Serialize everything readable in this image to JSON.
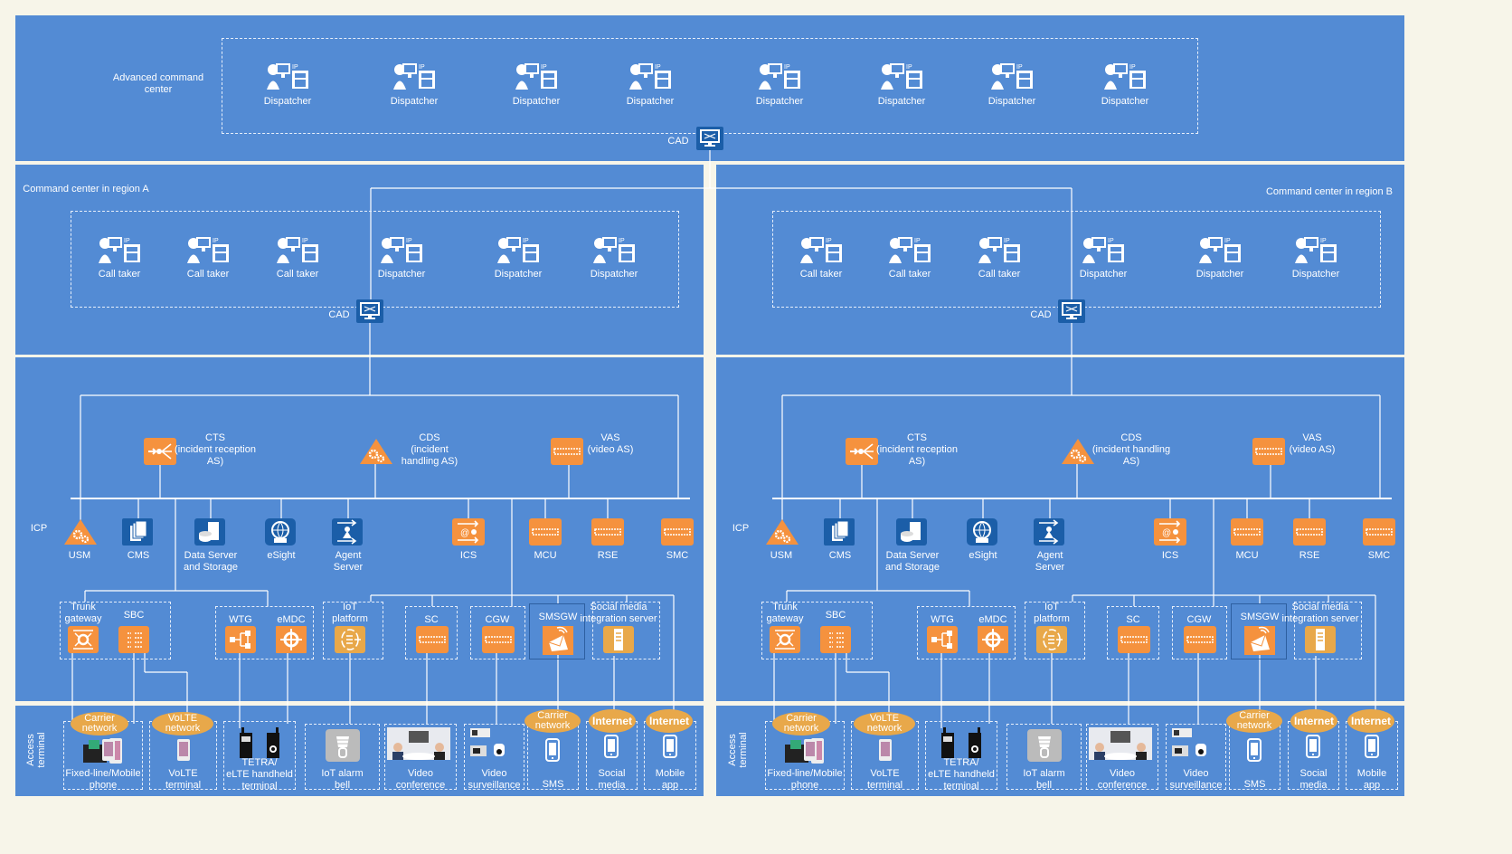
{
  "colors": {
    "background": "#f7f5e9",
    "panel": "#538bd4",
    "orange": "#f5923e",
    "gold": "#e8a84a",
    "blue_icon": "#1b5ea8",
    "line": "#ffffff"
  },
  "top": {
    "label": "Advanced command center",
    "dispatchers": [
      "Dispatcher",
      "Dispatcher",
      "Dispatcher",
      "Dispatcher",
      "Dispatcher",
      "Dispatcher",
      "Dispatcher",
      "Dispatcher"
    ],
    "cad": "CAD"
  },
  "regions": [
    {
      "label": "Command center in region A",
      "seats": [
        "Call taker",
        "Call taker",
        "Call taker",
        "Dispatcher",
        "Dispatcher",
        "Dispatcher"
      ],
      "cad": "CAD",
      "servers": [
        {
          "label": "CTS\n(incident reception\nAS)",
          "icon": "split-arrow-icon"
        },
        {
          "label": "CDS\n(incident\nhandling AS)",
          "icon": "gears-triangle-icon"
        },
        {
          "label": "VAS\n(video AS)",
          "icon": "server-rack-icon"
        }
      ],
      "icp_label": "ICP",
      "icp": [
        {
          "label": "USM",
          "icon": "gears-triangle-icon"
        },
        {
          "label": "CMS",
          "icon": "documents-icon"
        },
        {
          "label": "Data Server\nand Storage",
          "icon": "database-icon"
        },
        {
          "label": "eSight",
          "icon": "globe-icon"
        },
        {
          "label": "Agent\nServer",
          "icon": "agent-icon"
        },
        {
          "label": "ICS",
          "icon": "email-arrows-icon"
        },
        {
          "label": "MCU",
          "icon": "server-rack-icon"
        },
        {
          "label": "RSE",
          "icon": "server-rack-icon"
        },
        {
          "label": "SMC",
          "icon": "server-rack-icon"
        }
      ],
      "groups": [
        {
          "labels": [
            "Trunk\ngateway",
            "SBC"
          ]
        },
        {
          "labels": [
            "WTG",
            "eMDC"
          ]
        },
        {
          "labels": [
            "IoT\nplatform"
          ]
        },
        {
          "labels": [
            "SC"
          ]
        },
        {
          "labels": [
            "CGW"
          ]
        },
        {
          "labels": [
            "SMSGW"
          ]
        },
        {
          "labels": [
            "Social media\nintegration server"
          ]
        }
      ],
      "access_label": "Access\nterminal",
      "terminals": [
        "Fixed-line/Mobile\nphone",
        "VoLTE\nterminal",
        "TETRA/\neLTE handheld\nterminal",
        "IoT alarm\nbell",
        "Video\nconference",
        "Video\nsurveillance",
        "SMS",
        "Social\nmedia",
        "Mobile\napp"
      ],
      "clouds": [
        "Carrier\nnetwork",
        "VoLTE\nnetwork",
        "Carrier\nnetwork",
        "Internet",
        "Internet"
      ]
    },
    {
      "label": "Command center in region B",
      "seats": [
        "Call taker",
        "Call taker",
        "Call taker",
        "Dispatcher",
        "Dispatcher",
        "Dispatcher"
      ],
      "cad": "CAD",
      "servers": [
        {
          "label": "CTS\n(incident reception\nAS)",
          "icon": "split-arrow-icon"
        },
        {
          "label": "CDS\n(incident handling\nAS)",
          "icon": "gears-triangle-icon"
        },
        {
          "label": "VAS\n(video AS)",
          "icon": "server-rack-icon"
        }
      ],
      "icp_label": "ICP",
      "icp": [
        {
          "label": "USM",
          "icon": "gears-triangle-icon"
        },
        {
          "label": "CMS",
          "icon": "documents-icon"
        },
        {
          "label": "Data Server\nand Storage",
          "icon": "database-icon"
        },
        {
          "label": "eSight",
          "icon": "globe-icon"
        },
        {
          "label": "Agent\nServer",
          "icon": "agent-icon"
        },
        {
          "label": "ICS",
          "icon": "email-arrows-icon"
        },
        {
          "label": "MCU",
          "icon": "server-rack-icon"
        },
        {
          "label": "RSE",
          "icon": "server-rack-icon"
        },
        {
          "label": "SMC",
          "icon": "server-rack-icon"
        }
      ],
      "groups": [
        {
          "labels": [
            "Trunk\ngateway",
            "SBC"
          ]
        },
        {
          "labels": [
            "WTG",
            "eMDC"
          ]
        },
        {
          "labels": [
            "IoT\nplatform"
          ]
        },
        {
          "labels": [
            "SC"
          ]
        },
        {
          "labels": [
            "CGW"
          ]
        },
        {
          "labels": [
            "SMSGW"
          ]
        },
        {
          "labels": [
            "Social media\nintegration server"
          ]
        }
      ],
      "access_label": "Access\nterminal",
      "terminals": [
        "Fixed-line/Mobile\nphone",
        "VoLTE\nterminal",
        "TETRA/\neLTE handheld\nterminal",
        "IoT alarm\nbell",
        "Video\nconference",
        "Video\nsurveillance",
        "SMS",
        "Social\nmedia",
        "Mobile\napp"
      ],
      "clouds": [
        "Carrier\nnetwork",
        "VoLTE\nnetwork",
        "Carrier\nnetwork",
        "Internet",
        "Internet"
      ]
    }
  ]
}
